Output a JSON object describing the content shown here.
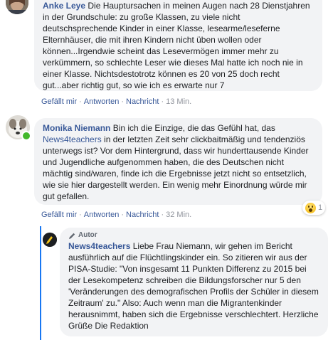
{
  "comments": [
    {
      "author": "Anke Leye",
      "text": " Die Hauptursachen in meinen Augen nach 28 Dienstjahren in der Grundschule: zu große Klassen, zu viele nicht deutschsprechende Kinder in einer Klasse, lesearme/leseferne Elternhäuser, die mit ihren Kindern nicht üben wollen oder können...Irgendwie scheint das Lesevermögen immer mehr zu verkümmern, so schlechte Leser wie dieses Mal hatte ich noch nie in einer Klasse. Nichtsdestotrotz können es 20 von 25 doch recht gut...aber richtig gut, so wie ich es erwarte nur 7",
      "like": "Gefällt mir",
      "reply": "Antworten",
      "share": "Nachricht",
      "time": "13 Min."
    },
    {
      "author": "Monika Niemann",
      "text_before": " Bin ich die Einzige, die das Gefühl hat, das ",
      "link": "News4teachers",
      "text_after": " in der letzten Zeit sehr clickbaitmäßig und tendenziös unterwegs ist? Vor dem Hintergrund, dass wir hunderttausende Kinder und Jugendliche aufgenommen haben, die des Deutschen nicht mächtig sind/waren, finde ich die Ergebnisse jetzt nicht so entsetzlich, wie sie hier dargestellt werden. Ein wenig mehr Einordnung würde mir gut gefallen.",
      "like": "Gefällt mir",
      "reply": "Antworten",
      "share": "Nachricht",
      "time": "32 Min.",
      "reaction_count": "1"
    },
    {
      "badge": "Autor",
      "author": "News4teachers",
      "text": " Liebe Frau Niemann, wir gehen im Bericht ausführlich auf die Flüchtlingskinder ein. So zitieren wir aus der PISA-Studie: \"Von insgesamt 11 Punkten Differenz zu 2015 bei der Lesekompetenz schreiben die Bildungsforscher nur 5 den 'Veränderungen des demografischen Profils der Schüler in diesem Zeitraum' zu.\" Also: Auch wenn man die Migrantenkinder herausnimmt, haben sich die Ergebnisse verschlechtert. Herzliche Grüße Die Redaktion"
    }
  ],
  "separator": "·",
  "colors": {
    "accent": "#385898",
    "bubble": "#f2f3f5",
    "online": "#42b72a",
    "reply_line": "#1877f2"
  }
}
